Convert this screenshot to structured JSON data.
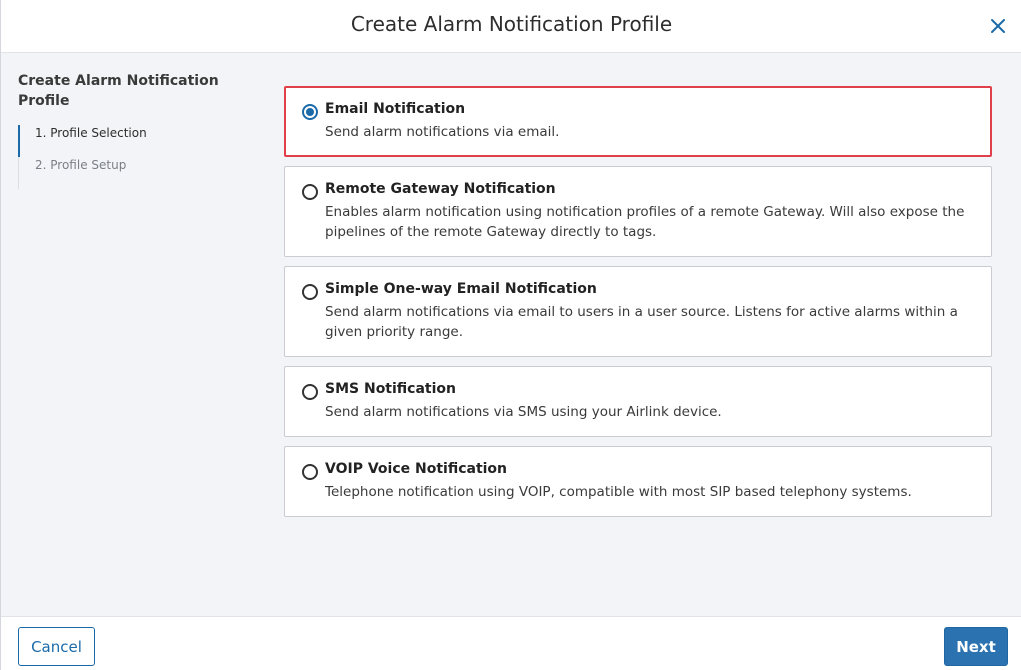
{
  "dialog": {
    "title": "Create Alarm Notification Profile",
    "close_icon": "close-icon"
  },
  "sidebar": {
    "title": "Create Alarm Notification Profile",
    "steps": [
      {
        "label": "1. Profile Selection",
        "active": true
      },
      {
        "label": "2. Profile Setup",
        "active": false
      }
    ]
  },
  "options": [
    {
      "title": "Email Notification",
      "description": "Send alarm notifications via email.",
      "selected": true
    },
    {
      "title": "Remote Gateway Notification",
      "description": "Enables alarm notification using notification profiles of a remote Gateway. Will also expose the pipelines of the remote Gateway directly to tags.",
      "selected": false
    },
    {
      "title": "Simple One-way Email Notification",
      "description": "Send alarm notifications via email to users in a user source. Listens for active alarms within a given priority range.",
      "selected": false
    },
    {
      "title": "SMS Notification",
      "description": "Send alarm notifications via SMS using your Airlink device.",
      "selected": false
    },
    {
      "title": "VOIP Voice Notification",
      "description": "Telephone notification using VOIP, compatible with most SIP based telephony systems.",
      "selected": false
    }
  ],
  "footer": {
    "cancel_label": "Cancel",
    "next_label": "Next"
  },
  "colors": {
    "accent": "#1b6aa8",
    "selected_border": "#e0404a",
    "background": "#f3f4f7"
  }
}
